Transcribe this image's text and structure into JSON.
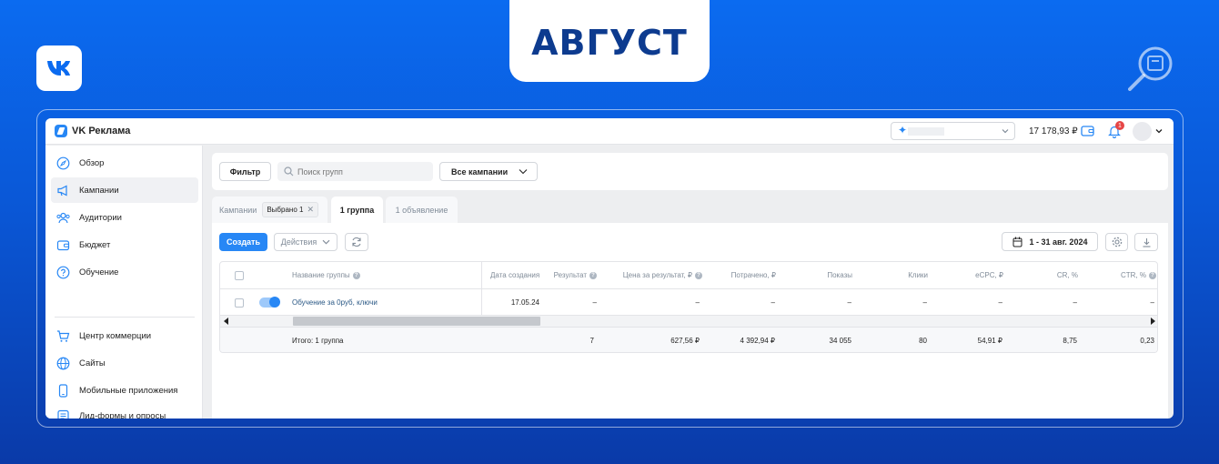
{
  "banner": {
    "month": "АВГУСТ"
  },
  "app": {
    "brand": "VK Реклама",
    "balance": "17 178,93 ₽",
    "notifications_count": "1"
  },
  "sidebar": {
    "items": [
      {
        "label": "Обзор",
        "icon": "compass-icon"
      },
      {
        "label": "Кампании",
        "icon": "megaphone-icon",
        "active": true
      },
      {
        "label": "Аудитории",
        "icon": "users-icon"
      },
      {
        "label": "Бюджет",
        "icon": "wallet-icon"
      },
      {
        "label": "Обучение",
        "icon": "question-icon"
      },
      {
        "label": "Центр коммерции",
        "icon": "cart-icon"
      },
      {
        "label": "Сайты",
        "icon": "globe-icon"
      },
      {
        "label": "Мобильные приложения",
        "icon": "phone-icon"
      },
      {
        "label": "Лид-формы и опросы",
        "icon": "form-icon"
      }
    ]
  },
  "toolbar": {
    "filter_label": "Фильтр",
    "search_placeholder": "Поиск групп",
    "campaign_select": "Все кампании"
  },
  "tabs": {
    "campaigns": "Кампании",
    "selected_chip": "Выбрано 1",
    "groups": "1 группа",
    "ads": "1 объявление"
  },
  "panel": {
    "create_label": "Создать",
    "actions_label": "Действия",
    "date_range": "1 - 31 авг. 2024"
  },
  "table": {
    "columns": [
      "Название группы",
      "Дата создания",
      "Результат",
      "Цена за результат, ₽",
      "Потрачено, ₽",
      "Показы",
      "Клики",
      "eCPC, ₽",
      "CR, %",
      "CTR, %"
    ],
    "row": {
      "name": "Обучение за 0руб, ключи",
      "created": "17.05.24",
      "result": "–",
      "price": "–",
      "spent": "–",
      "impressions": "–",
      "clicks": "–",
      "ecpc": "–",
      "cr": "–",
      "ctr": "–"
    },
    "total": {
      "label": "Итого: 1 группа",
      "result": "7",
      "price": "627,56 ₽",
      "spent": "4 392,94 ₽",
      "impressions": "34 055",
      "clicks": "80",
      "ecpc": "54,91 ₽",
      "cr": "8,75",
      "ctr": "0,23"
    }
  },
  "colors": {
    "background_top": "#0b6bf0",
    "background_bottom": "#0a3aa8",
    "accent": "#2787f5",
    "month_text": "#0d3b8f"
  }
}
